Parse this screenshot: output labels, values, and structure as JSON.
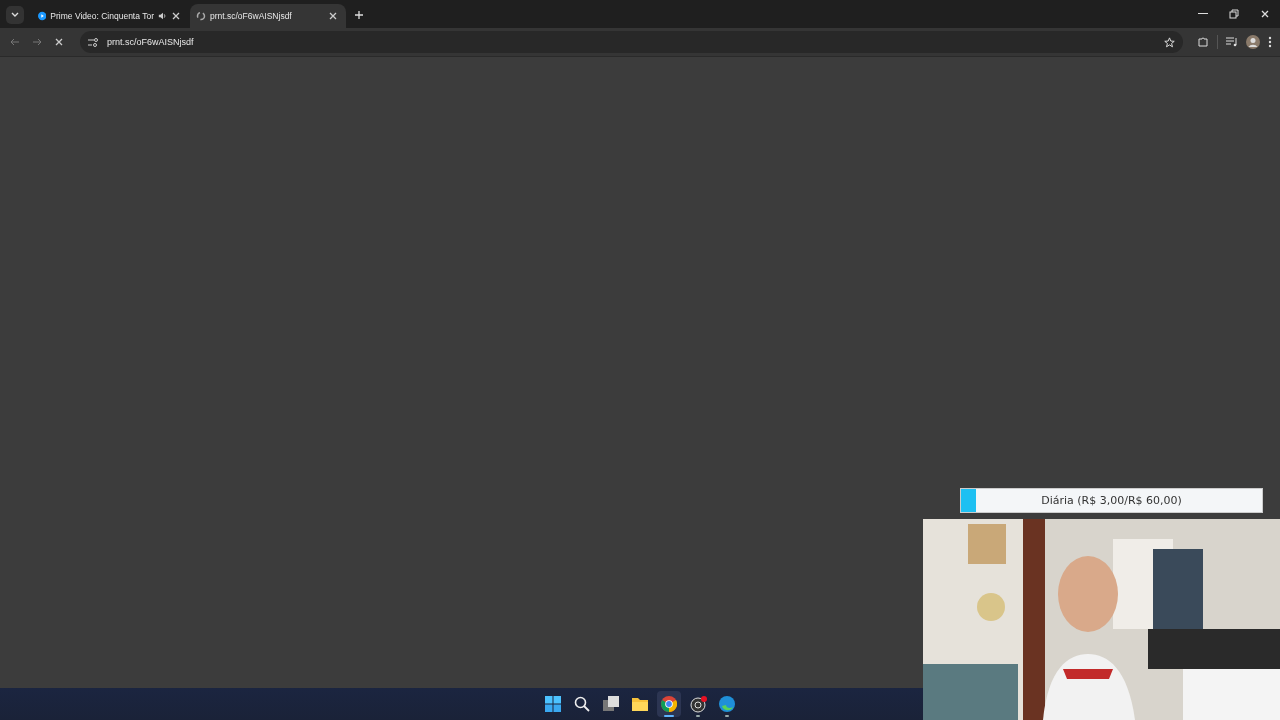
{
  "tabs": [
    {
      "title": "Prime Video: Cinquenta Tor",
      "selected": false,
      "audio": true
    },
    {
      "title": "prnt.sc/oF6wAISNjsdf",
      "selected": true,
      "audio": false
    }
  ],
  "toolbar": {
    "url": "prnt.sc/oF6wAISNjsdf",
    "loading": true
  },
  "overlay": {
    "goal": {
      "label": "Diária (R$ 3,00/R$ 60,00)",
      "level": 0.05
    }
  },
  "taskbar": {
    "apps": [
      {
        "kind": "start",
        "selected": false
      },
      {
        "kind": "search",
        "selected": false
      },
      {
        "kind": "taskview",
        "selected": false
      },
      {
        "kind": "files",
        "selected": false
      },
      {
        "kind": "chrome",
        "selected": true
      },
      {
        "kind": "obs",
        "selected": false
      },
      {
        "kind": "edge",
        "selected": false
      }
    ]
  }
}
